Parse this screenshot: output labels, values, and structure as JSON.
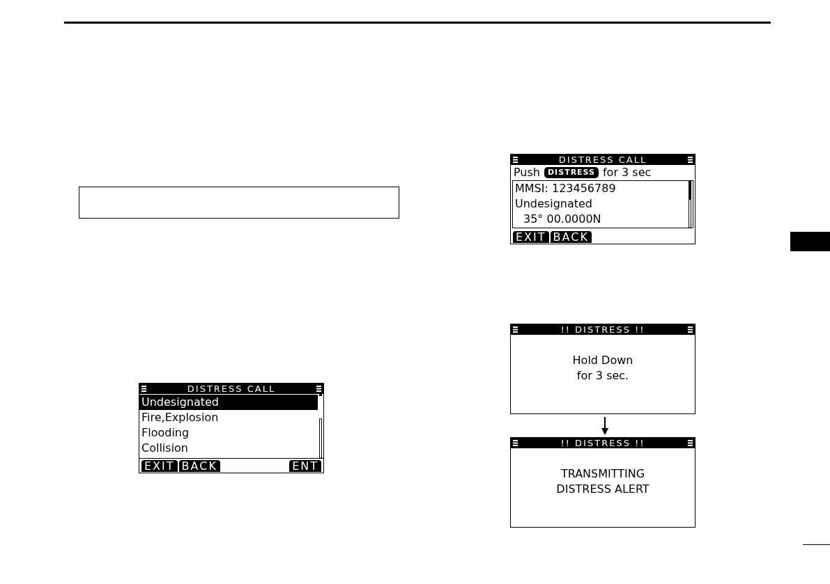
{
  "left_column": {
    "screens": [
      {
        "kind": "menu",
        "title": "DISTRESS CALL",
        "items": [
          {
            "label": "Undesignated",
            "selected": true
          },
          {
            "label": "Fire,Explosion",
            "selected": false
          },
          {
            "label": "Flooding",
            "selected": false
          },
          {
            "label": "Collision",
            "selected": false
          }
        ],
        "softkeys": {
          "left": [
            "EXIT",
            "BACK"
          ],
          "right": [
            "ENT"
          ]
        }
      }
    ]
  },
  "right_column": {
    "screens": [
      {
        "kind": "confirm",
        "title": "DISTRESS CALL",
        "prompt": {
          "before": "Push",
          "key": "DISTRESS",
          "after": "for 3 sec"
        },
        "lines": [
          "MMSI: 123456789",
          "Undesignated",
          "35° 00.0000N"
        ],
        "softkeys": {
          "left": [
            "EXIT",
            "BACK"
          ]
        }
      }
    ],
    "sequence": [
      {
        "kind": "message",
        "title": "!! DISTRESS !!",
        "message": [
          "Hold Down",
          "for 3 sec."
        ]
      },
      {
        "kind": "message",
        "title": "!! DISTRESS !!",
        "message": [
          "TRANSMITTING",
          "DISTRESS ALERT"
        ]
      }
    ]
  }
}
